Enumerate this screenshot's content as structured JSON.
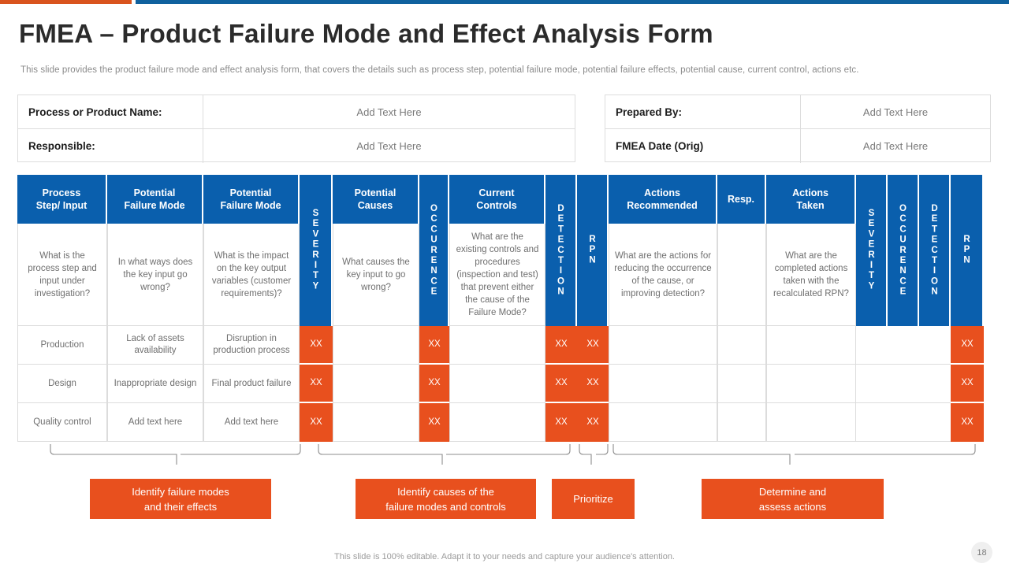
{
  "accent": {
    "orange": "#D9541E",
    "blue": "#10619E"
  },
  "theme": {
    "header_blue": "#0A5FAD",
    "orange": "#E8501E",
    "body_text": "#6f6f6f"
  },
  "header": {
    "title": "FMEA – Product Failure Mode and Effect Analysis Form",
    "subtitle": "This slide provides the product failure mode and effect analysis form, that covers the details such as process step, potential failure mode, potential failure effects, potential cause, current control, actions etc."
  },
  "info": {
    "left": [
      {
        "label": "Process or Product Name:",
        "value": "Add Text Here"
      },
      {
        "label": "Responsible:",
        "value": "Add Text Here"
      }
    ],
    "right": [
      {
        "label": "Prepared By:",
        "value": "Add Text Here"
      },
      {
        "label": "FMEA Date (Orig)",
        "value": "Add Text Here"
      }
    ]
  },
  "table": {
    "columns": [
      {
        "header": "Process\nStep/ Input",
        "desc": "What is the process step and input under investigation?",
        "vertical": false
      },
      {
        "header": "Potential\nFailure Mode",
        "desc": "In what ways does the key input go wrong?",
        "vertical": false
      },
      {
        "header": "Potential\nFailure Mode",
        "desc": "What is the impact on the key output variables (customer requirements)?",
        "vertical": false
      },
      {
        "header": "SEVERITY",
        "desc": "",
        "vertical": true
      },
      {
        "header": "Potential\nCauses",
        "desc": "What causes the key input to go wrong?",
        "vertical": false
      },
      {
        "header": "OCCURENCE",
        "desc": "",
        "vertical": true
      },
      {
        "header": "Current\nControls",
        "desc": "What are the existing controls and procedures (inspection and test) that prevent either the cause of the Failure Mode?",
        "vertical": false
      },
      {
        "header": "DETECTION",
        "desc": "",
        "vertical": true
      },
      {
        "header": "RPN",
        "desc": "",
        "vertical": true
      },
      {
        "header": "Actions\nRecommended",
        "desc": "What are the actions for reducing the occurrence of the cause, or improving detection?",
        "vertical": false
      },
      {
        "header": "Resp.",
        "desc": "",
        "vertical": false
      },
      {
        "header": "Actions\nTaken",
        "desc": "What are the completed actions taken with the recalculated RPN?",
        "vertical": false
      },
      {
        "header": "SEVERITY",
        "desc": "",
        "vertical": true
      },
      {
        "header": "OCCURENCE",
        "desc": "",
        "vertical": true
      },
      {
        "header": "DETECTION",
        "desc": "",
        "vertical": true
      },
      {
        "header": "RPN",
        "desc": "",
        "vertical": true
      }
    ],
    "rows": [
      [
        "Production",
        "Lack of assets availability",
        "Disruption in production process",
        "XX",
        "",
        "XX",
        "",
        "XX",
        "XX",
        "",
        "",
        "",
        "",
        "",
        "",
        "XX"
      ],
      [
        "Design",
        "Inappropriate design",
        "Final product failure",
        "XX",
        "",
        "XX",
        "",
        "XX",
        "XX",
        "",
        "",
        "",
        "",
        "",
        "",
        "XX"
      ],
      [
        "Quality control",
        "Add text here",
        "Add text here",
        "XX",
        "",
        "XX",
        "",
        "XX",
        "XX",
        "",
        "",
        "",
        "",
        "",
        "",
        "XX"
      ]
    ]
  },
  "callouts": [
    {
      "label": "Identify failure modes\nand their effects"
    },
    {
      "label": "Identify causes of the\nfailure modes and controls"
    },
    {
      "label": "Prioritize"
    },
    {
      "label": "Determine and\nassess actions"
    }
  ],
  "footer": {
    "note": "This slide is 100% editable. Adapt it to your needs and capture your audience's attention.",
    "page_number": "18"
  }
}
